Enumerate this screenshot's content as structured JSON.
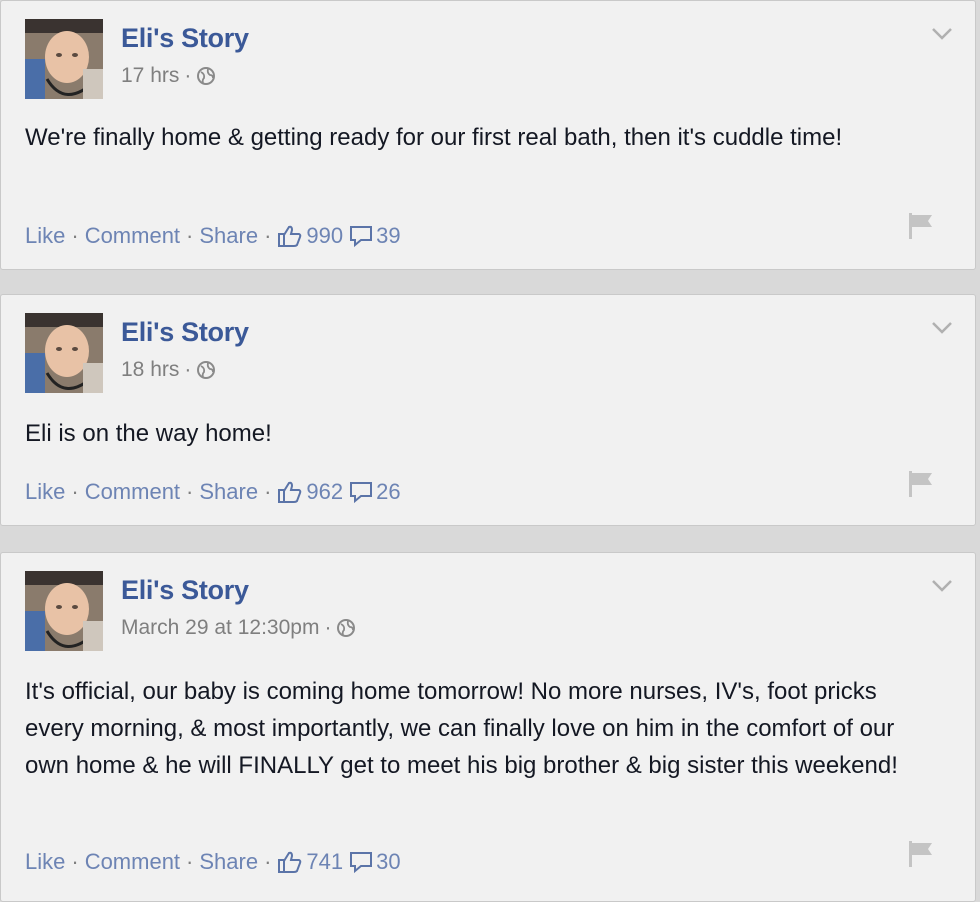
{
  "posts": [
    {
      "author": "Eli's Story",
      "time": "17 hrs",
      "separator": "·",
      "text": "We're finally home & getting ready for our first real bath, then it's cuddle time!",
      "actions": {
        "like": "Like",
        "comment": "Comment",
        "share": "Share"
      },
      "likes": "990",
      "comments": "39"
    },
    {
      "author": "Eli's Story",
      "time": "18 hrs",
      "separator": "·",
      "text": "Eli is on the way home!",
      "actions": {
        "like": "Like",
        "comment": "Comment",
        "share": "Share"
      },
      "likes": "962",
      "comments": "26"
    },
    {
      "author": "Eli's Story",
      "time": "March 29 at 12:30pm",
      "separator": "·",
      "text": "It's official, our baby is coming home tomorrow! No more nurses, IV's, foot pricks every morning, & most importantly, we can finally love on him in the comfort of our own home & he will FINALLY get to meet his big brother & big sister this weekend!",
      "actions": {
        "like": "Like",
        "comment": "Comment",
        "share": "Share"
      },
      "likes": "741",
      "comments": "30"
    }
  ],
  "colors": {
    "link": "#3b5998",
    "action": "#6d84b4",
    "meta": "#7f7f7f",
    "card": "#f1f1f1",
    "background": "#d9d9d9"
  },
  "icons": {
    "audience": "globe-icon",
    "menu": "chevron-down-icon",
    "report": "flag-icon",
    "likes": "thumbs-up-icon",
    "comments": "comment-bubble-icon"
  }
}
